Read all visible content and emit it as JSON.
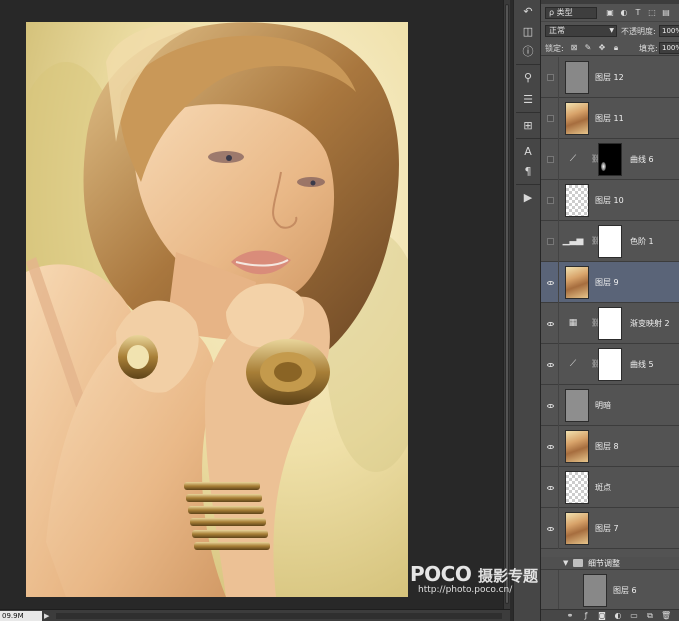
{
  "status": {
    "zoom": "09.9M",
    "arrow": "▶"
  },
  "layers_panel": {
    "filter_kind": "ρ 类型",
    "filter_icons": [
      "image-filter-icon",
      "adjustment-filter-icon",
      "type-filter-icon",
      "shape-filter-icon",
      "smart-object-filter-icon"
    ],
    "blend_mode": "正常",
    "opacity_label": "不透明度:",
    "opacity_value": "100%",
    "lock_label": "锁定:",
    "fill_label": "填充:",
    "fill_value": "100%",
    "layers": [
      {
        "name": "图层 12",
        "visible": false,
        "thumb": "gray"
      },
      {
        "name": "图层 11",
        "visible": false,
        "thumb": "photo"
      },
      {
        "name": "曲线 6",
        "visible": false,
        "adjustment": "curves",
        "mask": "black"
      },
      {
        "name": "图层 10",
        "visible": false,
        "thumb": "trans"
      },
      {
        "name": "色阶 1",
        "visible": false,
        "adjustment": "levels",
        "mask": "white"
      },
      {
        "name": "图层 9",
        "visible": true,
        "thumb": "photo",
        "selected": true
      },
      {
        "name": "渐变映射 2",
        "visible": true,
        "adjustment": "gradient-map",
        "mask": "white"
      },
      {
        "name": "曲线 5",
        "visible": true,
        "adjustment": "curves",
        "mask": "white"
      },
      {
        "name": "明暗",
        "visible": true,
        "thumb": "mingan"
      },
      {
        "name": "图层 8",
        "visible": true,
        "thumb": "photo"
      },
      {
        "name": "斑点",
        "visible": true,
        "thumb": "trans"
      },
      {
        "name": "图层 7",
        "visible": true,
        "thumb": "photo"
      }
    ],
    "group": {
      "name": "细节调整"
    },
    "after_group_layer": {
      "name": "图层 6",
      "thumb": "gray"
    }
  },
  "watermark": {
    "brand": "POCO",
    "subtitle": "摄影专题",
    "url": "http://photo.poco.cn/"
  }
}
